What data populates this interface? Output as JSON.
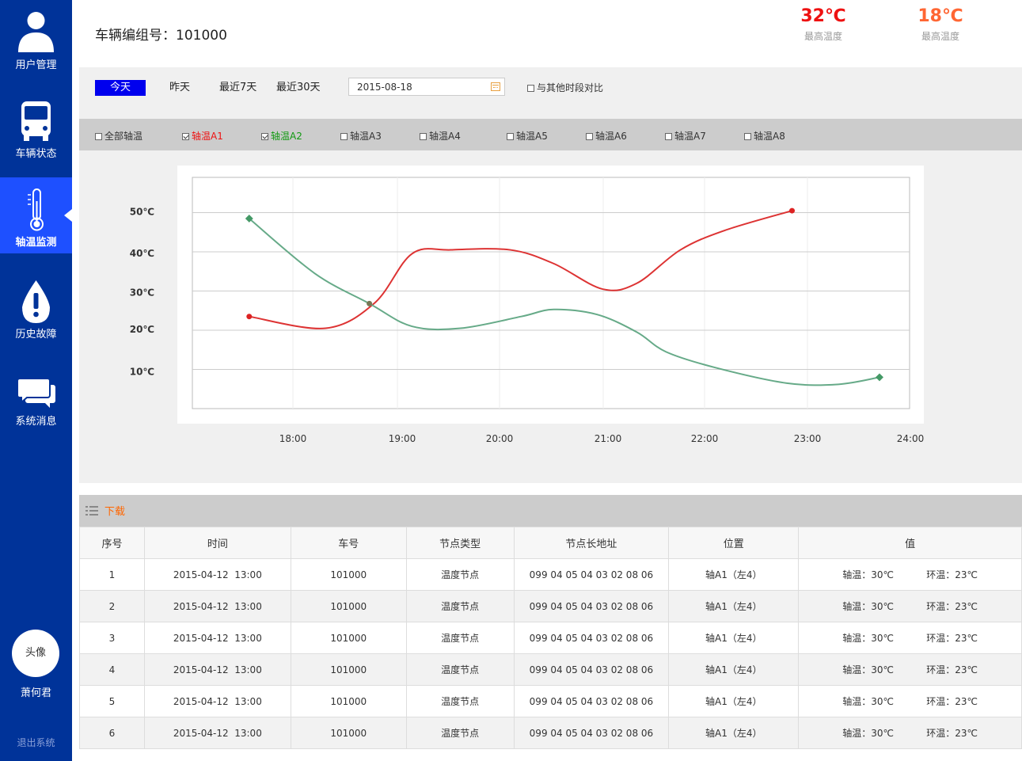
{
  "sidebar": {
    "items": [
      {
        "label": "用户管理",
        "icon": "user-icon"
      },
      {
        "label": "车辆状态",
        "icon": "bus-icon"
      },
      {
        "label": "轴温监测",
        "icon": "thermometer-icon",
        "active": true
      },
      {
        "label": "历史故障",
        "icon": "warning-drop-icon"
      },
      {
        "label": "系统消息",
        "icon": "chat-icon"
      }
    ],
    "avatar_label": "头像",
    "username": "萧何君",
    "logout": "退出系统"
  },
  "header": {
    "vehicle_title": "车辆编组号：101000",
    "temps": [
      {
        "value": "32℃",
        "label": "最高温度",
        "color": "#ee1111"
      },
      {
        "value": "18℃",
        "label": "最高温度",
        "color": "#ff6633"
      }
    ]
  },
  "filter": {
    "ranges": [
      "今天",
      "昨天",
      "最近7天",
      "最近30天"
    ],
    "active_range": "今天",
    "date": "2015-08-18",
    "compare_label": "与其他时段对比"
  },
  "axles": [
    {
      "label": "全部轴温",
      "checked": false,
      "color": "#333333"
    },
    {
      "label": "轴温A1",
      "checked": true,
      "color": "#ee1111"
    },
    {
      "label": "轴温A2",
      "checked": true,
      "color": "#119911"
    },
    {
      "label": "轴温A3",
      "checked": false,
      "color": "#333333"
    },
    {
      "label": "轴温A4",
      "checked": false,
      "color": "#333333"
    },
    {
      "label": "轴温A5",
      "checked": false,
      "color": "#333333"
    },
    {
      "label": "轴温A6",
      "checked": false,
      "color": "#333333"
    },
    {
      "label": "轴温A7",
      "checked": false,
      "color": "#333333"
    },
    {
      "label": "轴温A8",
      "checked": false,
      "color": "#333333"
    }
  ],
  "chart_data": {
    "type": "line",
    "x_ticks": [
      "18:00",
      "19:00",
      "20:00",
      "21:00",
      "22:00",
      "23:00",
      "24:00"
    ],
    "y_ticks": [
      "10℃",
      "20℃",
      "30℃",
      "40℃",
      "50℃"
    ],
    "ylim": [
      0,
      60
    ],
    "grid": true,
    "series": [
      {
        "color": "#dd3333",
        "points": [
          [
            17.6,
            23.5
          ],
          [
            18.3,
            20.5
          ],
          [
            18.75,
            27
          ],
          [
            19.1,
            39.5
          ],
          [
            19.5,
            40.5
          ],
          [
            20.1,
            40.5
          ],
          [
            20.5,
            37
          ],
          [
            20.95,
            30.5
          ],
          [
            21.3,
            32
          ],
          [
            21.75,
            40.5
          ],
          [
            22.2,
            45.5
          ],
          [
            22.85,
            50.5
          ]
        ]
      },
      {
        "color": "#66aa88",
        "points": [
          [
            17.6,
            48.5
          ],
          [
            18.2,
            34.5
          ],
          [
            18.7,
            26.8
          ],
          [
            19.1,
            21
          ],
          [
            19.6,
            20.5
          ],
          [
            20.2,
            23.5
          ],
          [
            20.5,
            25.3
          ],
          [
            20.9,
            24
          ],
          [
            21.3,
            19.5
          ],
          [
            21.6,
            14.5
          ],
          [
            22.1,
            10.5
          ],
          [
            22.8,
            6.5
          ],
          [
            23.3,
            6.2
          ],
          [
            23.7,
            8
          ]
        ]
      }
    ]
  },
  "table": {
    "download_label": "下载",
    "columns": [
      "序号",
      "时间",
      "车号",
      "节点类型",
      "节点长地址",
      "位置",
      "值"
    ],
    "rows": [
      {
        "no": "1",
        "time": "2015-04-12  13:00",
        "car": "101000",
        "type": "温度节点",
        "addr": "099 04 05 04 03 02 08 06",
        "pos": "轴A1（左4）",
        "axle": "轴温：30℃",
        "env": "环温：23℃"
      },
      {
        "no": "2",
        "time": "2015-04-12  13:00",
        "car": "101000",
        "type": "温度节点",
        "addr": "099 04 05 04 03 02 08 06",
        "pos": "轴A1（左4）",
        "axle": "轴温：30℃",
        "env": "环温：23℃"
      },
      {
        "no": "3",
        "time": "2015-04-12  13:00",
        "car": "101000",
        "type": "温度节点",
        "addr": "099 04 05 04 03 02 08 06",
        "pos": "轴A1（左4）",
        "axle": "轴温：30℃",
        "env": "环温：23℃"
      },
      {
        "no": "4",
        "time": "2015-04-12  13:00",
        "car": "101000",
        "type": "温度节点",
        "addr": "099 04 05 04 03 02 08 06",
        "pos": "轴A1（左4）",
        "axle": "轴温：30℃",
        "env": "环温：23℃"
      },
      {
        "no": "5",
        "time": "2015-04-12  13:00",
        "car": "101000",
        "type": "温度节点",
        "addr": "099 04 05 04 03 02 08 06",
        "pos": "轴A1（左4）",
        "axle": "轴温：30℃",
        "env": "环温：23℃"
      },
      {
        "no": "6",
        "time": "2015-04-12  13:00",
        "car": "101000",
        "type": "温度节点",
        "addr": "099 04 05 04 03 02 08 06",
        "pos": "轴A1（左4）",
        "axle": "轴温：30℃",
        "env": "环温：23℃"
      }
    ]
  }
}
